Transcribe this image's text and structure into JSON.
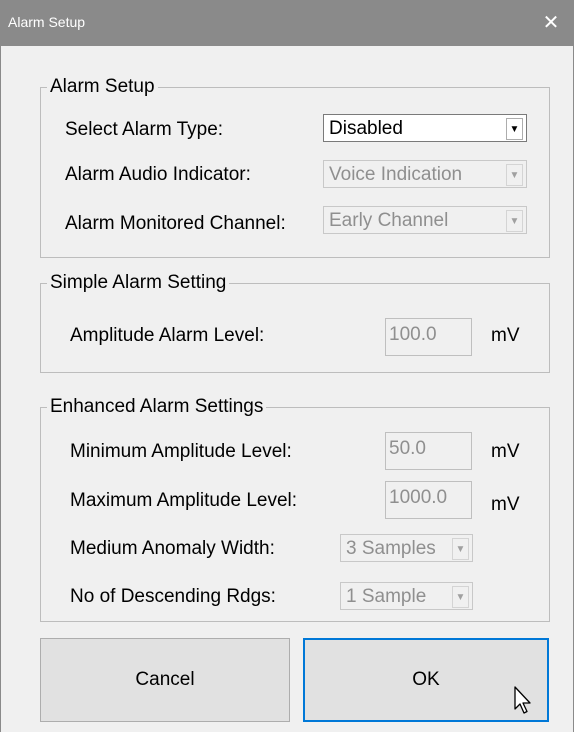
{
  "window": {
    "title": "Alarm Setup",
    "close_glyph": "✕"
  },
  "alarm_setup": {
    "legend": "Alarm Setup",
    "select_alarm_type": {
      "label": "Select Alarm Type:",
      "value": "Disabled"
    },
    "audio_indicator": {
      "label": "Alarm Audio Indicator:",
      "value": "Voice Indication"
    },
    "monitored_channel": {
      "label": "Alarm Monitored Channel:",
      "value": "Early Channel"
    }
  },
  "simple_alarm": {
    "legend": "Simple Alarm Setting",
    "amplitude_level": {
      "label": "Amplitude Alarm Level:",
      "value": "100.0",
      "unit": "mV"
    }
  },
  "enhanced_alarm": {
    "legend": "Enhanced Alarm Settings",
    "min_amplitude": {
      "label": "Minimum Amplitude Level:",
      "value": "50.0",
      "unit": "mV"
    },
    "max_amplitude": {
      "label": "Maximum Amplitude Level:",
      "value": "1000.0",
      "unit": "mV"
    },
    "anomaly_width": {
      "label": "Medium Anomaly Width:",
      "value": "3 Samples"
    },
    "descending_rdgs": {
      "label": "No of Descending Rdgs:",
      "value": "1 Sample"
    }
  },
  "buttons": {
    "cancel": "Cancel",
    "ok": "OK"
  },
  "icons": {
    "dropdown": "chevron-down-icon",
    "close": "close-icon",
    "cursor": "mouse-pointer-icon"
  },
  "colors": {
    "titlebar": "#8a8a8a",
    "dialog_bg": "#f0f0f0",
    "default_button_border": "#0078d7"
  }
}
